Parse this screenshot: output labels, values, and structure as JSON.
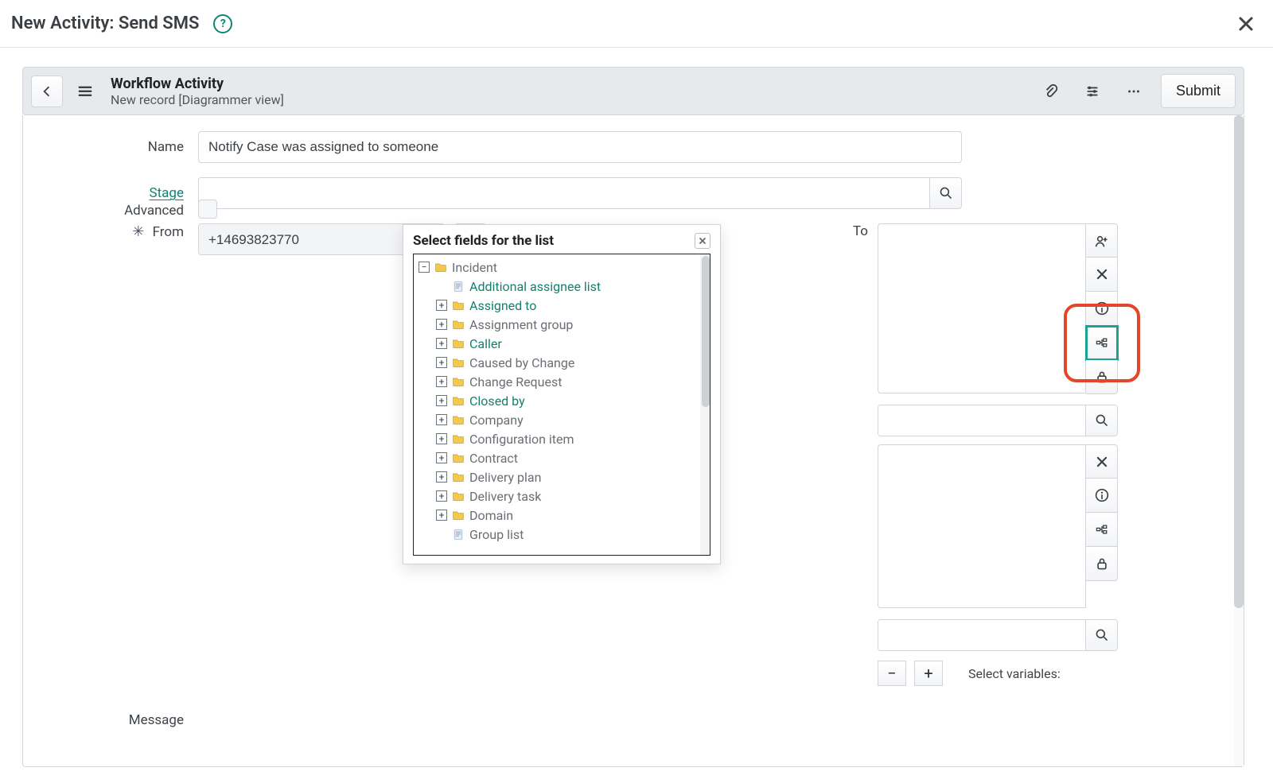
{
  "modal": {
    "title": "New Activity: Send SMS",
    "help_tooltip": "?",
    "close_label": "Close"
  },
  "wfHeader": {
    "back_label": "Back",
    "menu_label": "Menu",
    "title": "Workflow Activity",
    "subtitle": "New record [Diagrammer view]",
    "attachments_label": "Attachments",
    "settings_label": "Settings",
    "more_label": "More",
    "submit_label": "Submit"
  },
  "form": {
    "name_label": "Name",
    "name_value": "Notify Case was assigned to someone",
    "stage_label": "Stage",
    "stage_value": "",
    "from_label": "From",
    "from_required_mark": "✳",
    "from_value": "+14693823770",
    "info_label": "Info",
    "search_label": "Search",
    "advanced_label": "Advanced",
    "advanced_checked": false,
    "to_label": "To",
    "to_side": {
      "addperson_label": "Add me",
      "remove_label": "Remove",
      "info_label": "Info",
      "tree_label": "Select fields",
      "lock_label": "Lock"
    },
    "below_to_input_value": "",
    "third_side": {
      "remove_label": "Remove",
      "info_label": "Info",
      "tree_label": "Select fields",
      "lock_label": "Lock"
    },
    "message_label": "Message",
    "select_variables_label": "Select variables:",
    "minus_label": "−",
    "plus_label": "+"
  },
  "popup": {
    "title": "Select fields for the list",
    "close_label": "Close",
    "root": "Incident",
    "items": [
      {
        "label": "Additional assignee list",
        "link": true,
        "icon": "file"
      },
      {
        "label": "Assigned to",
        "link": true,
        "icon": "folder",
        "expandable": true
      },
      {
        "label": "Assignment group",
        "link": false,
        "icon": "folder",
        "expandable": true
      },
      {
        "label": "Caller",
        "link": true,
        "icon": "folder",
        "expandable": true
      },
      {
        "label": "Caused by Change",
        "link": false,
        "icon": "folder",
        "expandable": true
      },
      {
        "label": "Change Request",
        "link": false,
        "icon": "folder",
        "expandable": true
      },
      {
        "label": "Closed by",
        "link": true,
        "icon": "folder",
        "expandable": true
      },
      {
        "label": "Company",
        "link": false,
        "icon": "folder",
        "expandable": true
      },
      {
        "label": "Configuration item",
        "link": false,
        "icon": "folder",
        "expandable": true
      },
      {
        "label": "Contract",
        "link": false,
        "icon": "folder",
        "expandable": true
      },
      {
        "label": "Delivery plan",
        "link": false,
        "icon": "folder",
        "expandable": true
      },
      {
        "label": "Delivery task",
        "link": false,
        "icon": "folder",
        "expandable": true
      },
      {
        "label": "Domain",
        "link": false,
        "icon": "folder",
        "expandable": true
      },
      {
        "label": "Group list",
        "link": false,
        "icon": "file"
      }
    ]
  }
}
